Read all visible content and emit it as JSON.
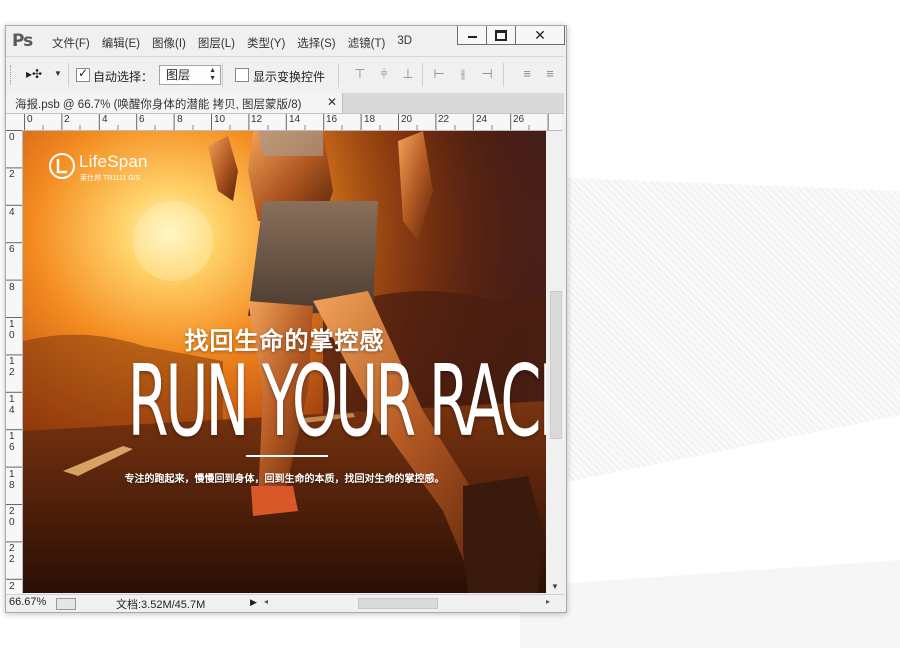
{
  "app": {
    "logo": "Ps"
  },
  "menu": [
    "文件(F)",
    "编辑(E)",
    "图像(I)",
    "图层(L)",
    "类型(Y)",
    "选择(S)",
    "滤镜(T)",
    "3D"
  ],
  "window_controls": {
    "close_glyph": "✕"
  },
  "toolbar": {
    "move_tool_glyph": "▸✣",
    "auto_select_label": "自动选择：",
    "auto_select_checked": true,
    "target_select_value": "图层",
    "show_transform_label": "显示变换控件",
    "show_transform_checked": false
  },
  "document_tab": {
    "title": "海报.psb @ 66.7% (唤醒你身体的潜能 拷贝, 图层蒙版/8)",
    "close_glyph": "✕"
  },
  "ruler": {
    "horizontal": [
      "0",
      "2",
      "4",
      "6",
      "8",
      "10",
      "12",
      "14",
      "16",
      "18",
      "20",
      "22",
      "24",
      "26"
    ],
    "vertical": [
      "0",
      "2",
      "4",
      "6",
      "8",
      "10",
      "12",
      "14",
      "16",
      "18",
      "20",
      "22",
      "2"
    ]
  },
  "poster": {
    "brand_name": "LifeSpan",
    "brand_sub": "莱仕邦 TR1111 G/S",
    "headline_cn": "找回生命的掌控感",
    "headline_en": "RUN YOUR RACE",
    "tagline": "专注的跑起来，慢慢回到身体，回到生命的本质，找回对生命的掌控感。"
  },
  "status": {
    "zoom": "66.67%",
    "doc_info": "文档:3.52M/45.7M"
  }
}
